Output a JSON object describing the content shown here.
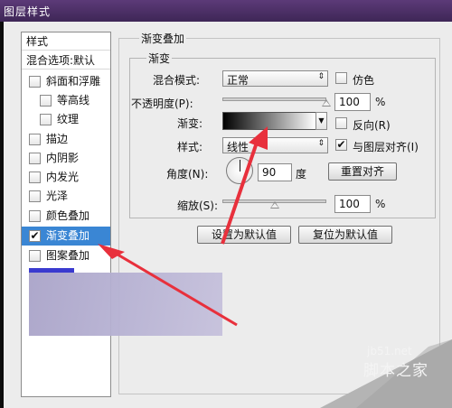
{
  "window": {
    "title": "图层样式"
  },
  "style_list": {
    "header": "样式",
    "blend_options": "混合选项:默认",
    "items": [
      {
        "label": "斜面和浮雕",
        "checked": false
      },
      {
        "label": "等高线",
        "checked": false
      },
      {
        "label": "纹理",
        "checked": false
      },
      {
        "label": "描边",
        "checked": false
      },
      {
        "label": "内阴影",
        "checked": false
      },
      {
        "label": "内发光",
        "checked": false
      },
      {
        "label": "光泽",
        "checked": false
      },
      {
        "label": "颜色叠加",
        "checked": false
      },
      {
        "label": "渐变叠加",
        "checked": true
      },
      {
        "label": "图案叠加",
        "checked": false
      }
    ]
  },
  "panel": {
    "section_title": "渐变叠加",
    "group_title": "渐变",
    "blend_mode": {
      "label": "混合模式:",
      "value": "正常"
    },
    "dither": {
      "label": "仿色",
      "checked": false
    },
    "opacity": {
      "label": "不透明度(P):",
      "value": "100",
      "unit": "%",
      "level": 100
    },
    "gradient": {
      "label": "渐变:",
      "start_color": "#000000",
      "end_color": "#ffffff"
    },
    "reverse": {
      "label": "反向(R)",
      "checked": false
    },
    "style": {
      "label": "样式:",
      "value": "线性"
    },
    "align": {
      "label": "与图层对齐(I)",
      "checked": true
    },
    "angle": {
      "label": "角度(N):",
      "value": "90",
      "unit": "度"
    },
    "reset_align_button": "重置对齐",
    "scale": {
      "label": "缩放(S):",
      "value": "100",
      "unit": "%",
      "level": 100
    },
    "make_default_button": "设置为默认值",
    "reset_default_button": "复位为默认值"
  },
  "colors": {
    "selection": "#3a86d4",
    "annotation_arrow": "#e8303c",
    "titlebar": "#4a2f64"
  },
  "watermark": {
    "domain": "jb51.net",
    "name": "脚本之家"
  }
}
